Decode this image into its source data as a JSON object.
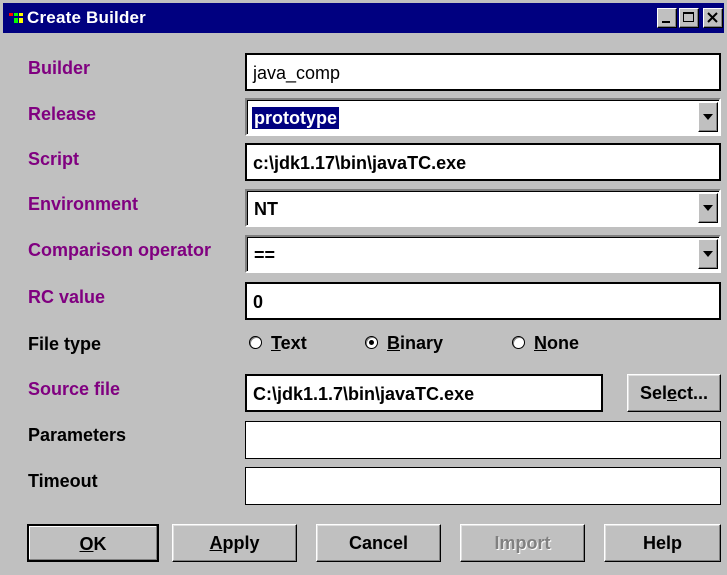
{
  "window": {
    "title": "Create Builder"
  },
  "fields": {
    "builder": {
      "label": "Builder",
      "value": "java_comp"
    },
    "release": {
      "label": "Release",
      "value": "prototype"
    },
    "script": {
      "label": "Script",
      "value": "c:\\jdk1.17\\bin\\javaTC.exe"
    },
    "environment": {
      "label": "Environment",
      "value": "NT"
    },
    "comparison": {
      "label": "Comparison operator",
      "value": "=="
    },
    "rc_value": {
      "label": "RC value",
      "value": "0"
    },
    "file_type": {
      "label": "File type",
      "options": [
        {
          "text": "Text",
          "mnemonic": "T",
          "rest": "ext",
          "selected": false
        },
        {
          "text": "Binary",
          "mnemonic": "B",
          "rest": "inary",
          "selected": true
        },
        {
          "text": "None",
          "mnemonic": "N",
          "rest": "one",
          "selected": false
        }
      ]
    },
    "source_file": {
      "label": "Source file",
      "value": "C:\\jdk1.1.7\\bin\\javaTC.exe",
      "select_pre": "Sel",
      "select_mn": "e",
      "select_post": "ct..."
    },
    "parameters": {
      "label": "Parameters",
      "value": ""
    },
    "timeout": {
      "label": "Timeout",
      "value": ""
    }
  },
  "buttons": {
    "ok": {
      "mn": "O",
      "rest": "K"
    },
    "apply": {
      "mn": "A",
      "rest": "pply"
    },
    "cancel": "Cancel",
    "import": "Import",
    "help": "Help"
  },
  "colors": {
    "titlebar": "#000080",
    "required_label": "#800080",
    "dialog_bg": "#c0c0c0"
  }
}
